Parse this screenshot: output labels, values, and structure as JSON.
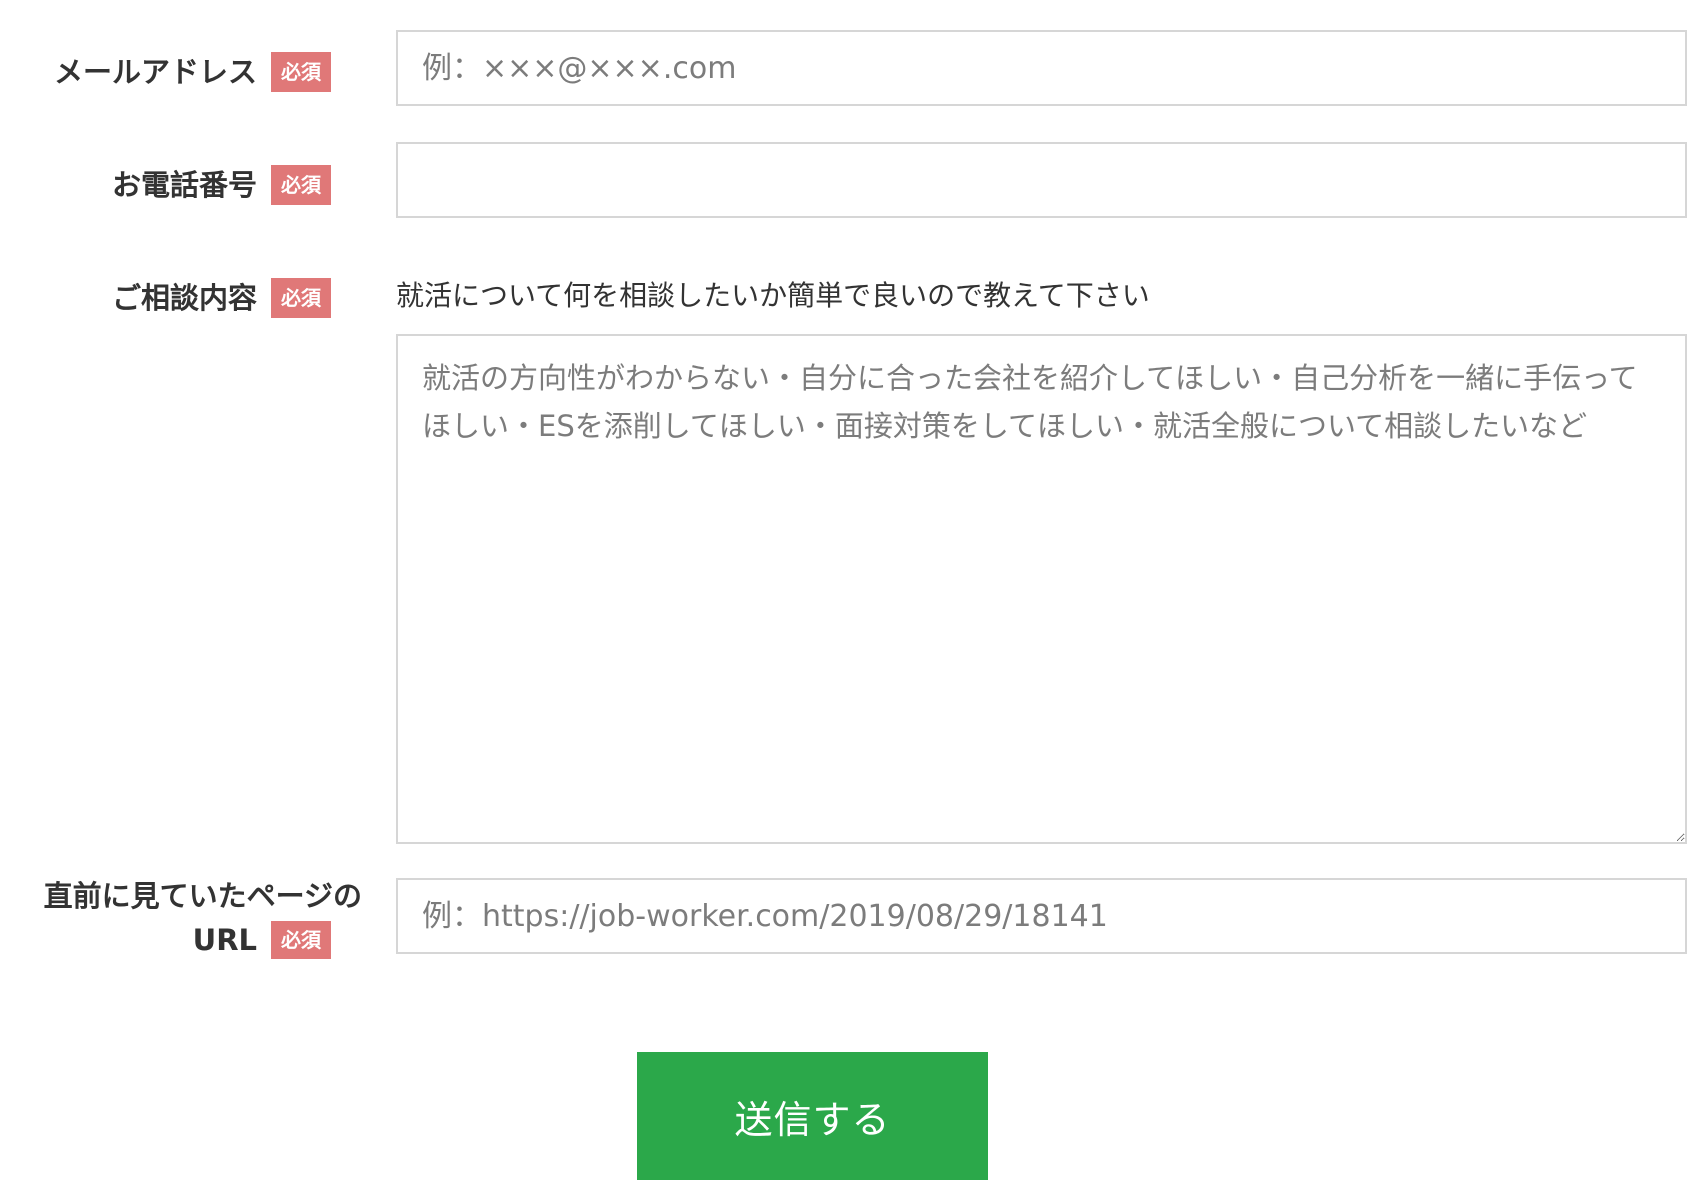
{
  "required_badge": "必須",
  "fields": {
    "email": {
      "label": "メールアドレス",
      "placeholder": "例：×××@×××.com",
      "value": ""
    },
    "phone": {
      "label": "お電話番号",
      "placeholder": "",
      "value": ""
    },
    "consultation": {
      "label": "ご相談内容",
      "hint": "就活について何を相談したいか簡単で良いので教えて下さい",
      "placeholder": "就活の方向性がわからない・自分に合った会社を紹介してほしい・自己分析を一緒に手伝ってほしい・ESを添削してほしい・面接対策をしてほしい・就活全般について相談したいなど",
      "value": ""
    },
    "previous_page": {
      "label_line1": "直前に見ていたページの",
      "label_line2": "URL",
      "placeholder": "例：https://job-worker.com/2019/08/29/18141",
      "value": ""
    }
  },
  "submit": {
    "label": "送信する",
    "color": "#2ba84a"
  },
  "colors": {
    "badge": "#e07878",
    "border": "#d6d6d6"
  }
}
